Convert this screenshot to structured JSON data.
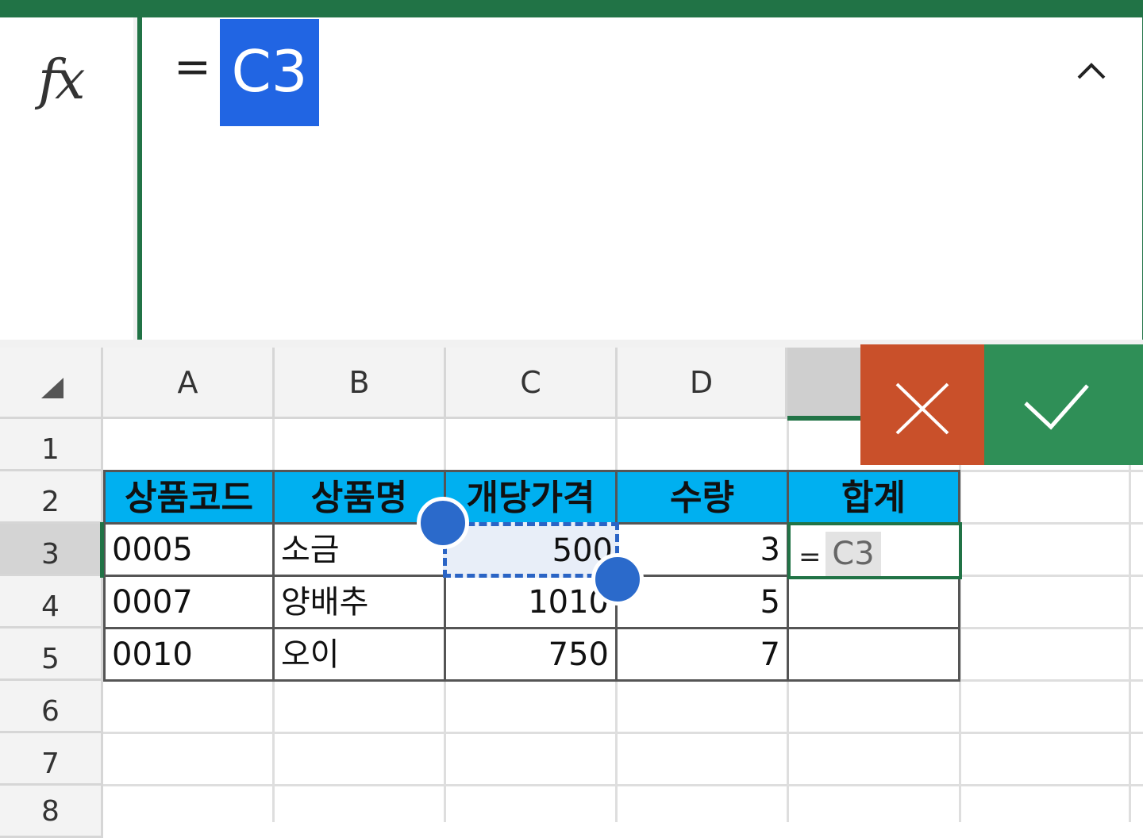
{
  "formula_bar": {
    "fx_label": "fx",
    "equals": "=",
    "reference": "C3",
    "collapse_icon": "chevron-up-icon"
  },
  "columns": [
    "A",
    "B",
    "C",
    "D"
  ],
  "rows": [
    "1",
    "2",
    "3",
    "4",
    "5",
    "6",
    "7",
    "8"
  ],
  "table": {
    "headers": [
      "상품코드",
      "상품명",
      "개당가격",
      "수량",
      "합계"
    ],
    "rows": [
      {
        "code": "0005",
        "name": "소금",
        "price": "500",
        "qty": "3"
      },
      {
        "code": "0007",
        "name": "양배추",
        "price": "1010",
        "qty": "5"
      },
      {
        "code": "0010",
        "name": "오이",
        "price": "750",
        "qty": "7"
      }
    ]
  },
  "edit_cell": {
    "equals": "=",
    "reference": "C3"
  },
  "actions": {
    "cancel_icon": "close-icon",
    "enter_icon": "checkmark-icon"
  },
  "colors": {
    "accent": "#217346",
    "header_fill": "#00b0f0",
    "cancel": "#c9502a",
    "enter": "#2f8f57",
    "ref_highlight": "#2165e3"
  }
}
